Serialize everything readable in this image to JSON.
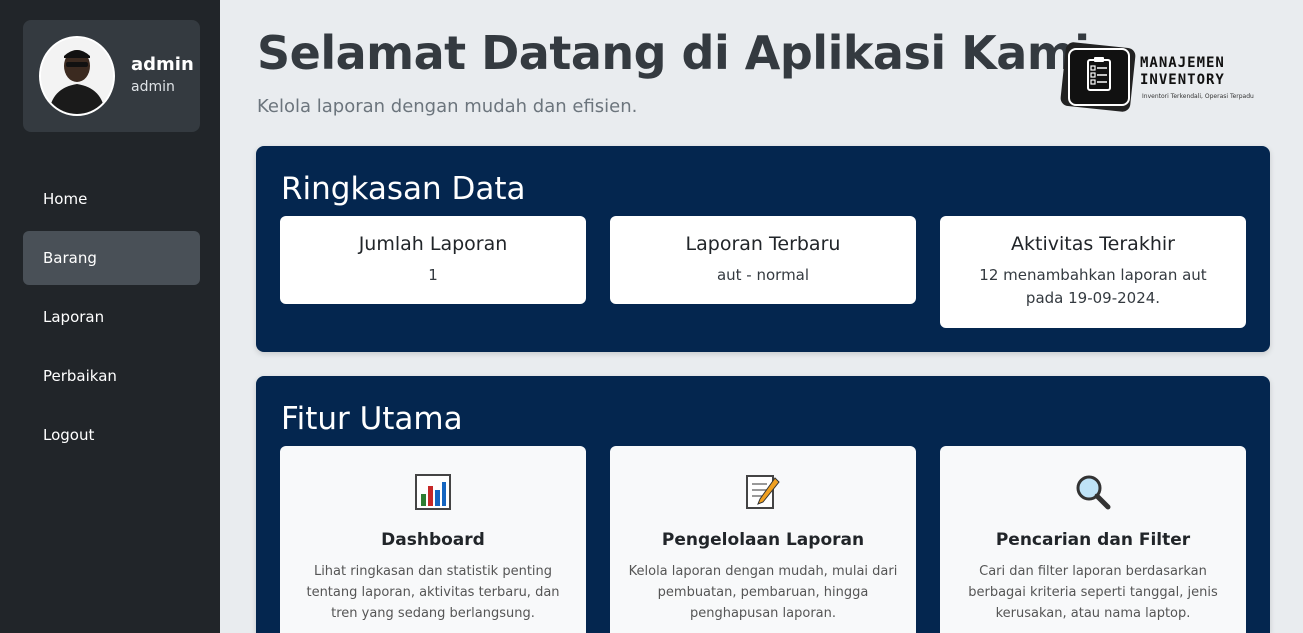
{
  "user": {
    "name": "admin",
    "role": "admin"
  },
  "nav": [
    {
      "label": "Home",
      "active": false
    },
    {
      "label": "Barang",
      "active": true
    },
    {
      "label": "Laporan",
      "active": false
    },
    {
      "label": "Perbaikan",
      "active": false
    },
    {
      "label": "Logout",
      "active": false
    }
  ],
  "header": {
    "title": "Selamat Datang di Aplikasi Kami",
    "subtitle": "Kelola laporan dengan mudah dan efisien."
  },
  "logo": {
    "line1": "MANAJEMEN",
    "line2": "INVENTORY",
    "tagline": "Inventori Terkendali, Operasi Terpadu"
  },
  "summary": {
    "heading": "Ringkasan Data",
    "cards": [
      {
        "title": "Jumlah Laporan",
        "value": "1"
      },
      {
        "title": "Laporan Terbaru",
        "value": "aut - normal"
      },
      {
        "title": "Aktivitas Terakhir",
        "value": "12 menambahkan laporan aut pada 19-09-2024."
      }
    ]
  },
  "features": {
    "heading": "Fitur Utama",
    "cards": [
      {
        "icon": "bar-chart-icon",
        "title": "Dashboard",
        "desc": "Lihat ringkasan dan statistik penting tentang laporan, aktivitas terbaru, dan tren yang sedang berlangsung."
      },
      {
        "icon": "memo-icon",
        "title": "Pengelolaan Laporan",
        "desc": "Kelola laporan dengan mudah, mulai dari pembuatan, pembaruan, hingga penghapusan laporan."
      },
      {
        "icon": "magnifier-icon",
        "title": "Pencarian dan Filter",
        "desc": "Cari dan filter laporan berdasarkan berbagai kriteria seperti tanggal, jenis kerusakan, atau nama laptop."
      }
    ]
  },
  "colors": {
    "sidebar": "#212529",
    "panel": "#04264f",
    "active_nav": "#495057",
    "background": "#e9ecef"
  }
}
